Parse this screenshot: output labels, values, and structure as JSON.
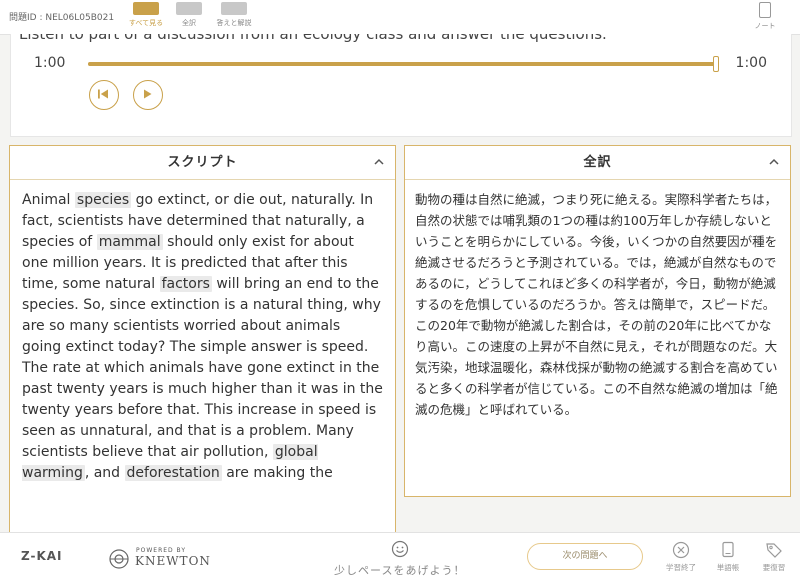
{
  "header": {
    "question_id": "問題ID : NEL06L05B021",
    "tabs": [
      {
        "label": "すべて見る",
        "active": true
      },
      {
        "label": "全訳",
        "active": false
      },
      {
        "label": "答えと解説",
        "active": false
      }
    ],
    "note_label": "ノート"
  },
  "audio": {
    "instruction": "Listen to part of a discussion from an ecology class and answer the questions.",
    "current_time": "1:00",
    "duration": "1:00",
    "progress": 1.0
  },
  "script_panel": {
    "title": "スクリプト",
    "segments": [
      {
        "text": "Animal ",
        "hl": false
      },
      {
        "text": "species",
        "hl": true
      },
      {
        "text": " go extinct, or die out, naturally. In fact, scientists have determined that naturally, a species of ",
        "hl": false
      },
      {
        "text": "mammal",
        "hl": true
      },
      {
        "text": " should only exist for about one million years. It is predicted that after this time, some natural ",
        "hl": false
      },
      {
        "text": "factors",
        "hl": true
      },
      {
        "text": " will bring an end to the species. So, since extinction is a natural thing, why are so many scientists worried about animals going extinct today? The simple answer is speed. The rate at which animals have gone extinct in the past twenty years is much higher than it was in the twenty years before that. This increase in speed is seen as unnatural, and that is a problem. Many scientists believe that air pollution, ",
        "hl": false
      },
      {
        "text": "global warming",
        "hl": true
      },
      {
        "text": ", and ",
        "hl": false
      },
      {
        "text": "deforestation",
        "hl": true
      },
      {
        "text": " are making the",
        "hl": false
      }
    ]
  },
  "translation_panel": {
    "title": "全訳",
    "text": "動物の種は自然に絶滅，つまり死に絶える。実際科学者たちは，自然の状態では哺乳類の1つの種は約100万年しか存続しないということを明らかにしている。今後，いくつかの自然要因が種を絶滅させるだろうと予測されている。では，絶滅が自然なものであるのに，どうしてこれほど多くの科学者が，今日，動物が絶滅するのを危惧しているのだろうか。答えは簡単で，スピードだ。この20年で動物が絶滅した割合は，その前の20年に比べてかなり高い。この速度の上昇が不自然に見え，それが問題なのだ。大気汚染，地球温暖化，森林伐採が動物の絶滅する割合を高めていると多くの科学者が信じている。この不自然な絶滅の増加は「絶滅の危機」と呼ばれている。"
  },
  "footer": {
    "logo_zkai": "Z-KAI",
    "powered_by": "POWERED BY",
    "knewton": "KNEWTON",
    "pace_message": "少しペースをあげよう！",
    "next_button": "次の問題へ",
    "icons": [
      {
        "name": "finish-study-icon",
        "label": "学習終了"
      },
      {
        "name": "vocabulary-icon",
        "label": "単語帳"
      },
      {
        "name": "review-tag-icon",
        "label": "要復習"
      }
    ]
  },
  "colors": {
    "accent": "#c9a14a",
    "panel_border": "#d8b56a",
    "highlight": "#eaeaea"
  }
}
